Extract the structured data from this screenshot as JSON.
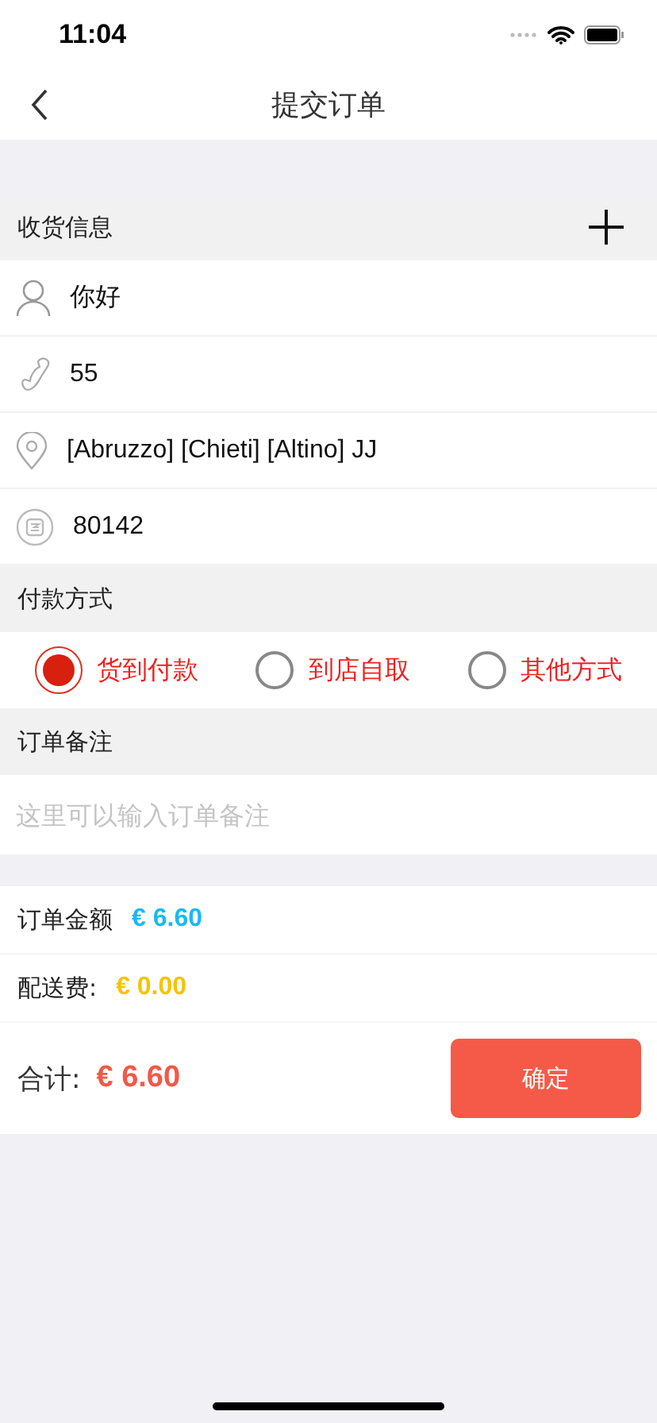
{
  "status_bar": {
    "time": "11:04"
  },
  "nav": {
    "title": "提交订单"
  },
  "shipping": {
    "title": "收货信息",
    "rows": [
      {
        "kind": "person",
        "text": "你好"
      },
      {
        "kind": "phone",
        "text": "55"
      },
      {
        "kind": "location",
        "text": "[Abruzzo] [Chieti] [Altino] JJ"
      },
      {
        "kind": "postcode",
        "text": "80142"
      }
    ]
  },
  "payment": {
    "title": "付款方式",
    "options": [
      {
        "label": "货到付款",
        "selected": true
      },
      {
        "label": "到店自取",
        "selected": false
      },
      {
        "label": "其他方式",
        "selected": false
      }
    ]
  },
  "note": {
    "title": "订单备注",
    "placeholder": "这里可以输入订单备注"
  },
  "summary": [
    {
      "label": "订单金额",
      "amount": "€ 6.60",
      "color": "#19b9f2"
    },
    {
      "label": "配送费:",
      "amount": "€ 0.00",
      "color": "#f5c400"
    }
  ],
  "total": {
    "label": "合计:",
    "amount": "€ 6.60",
    "button": "确定"
  }
}
